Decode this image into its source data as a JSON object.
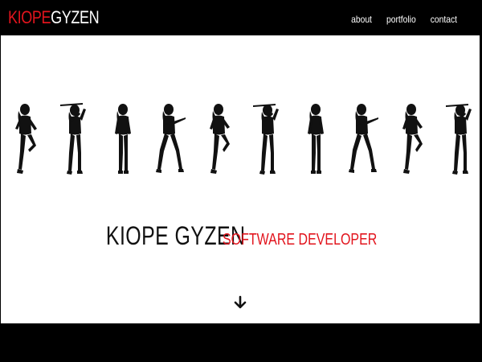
{
  "brand": {
    "part1": "KIOPE",
    "part2": "GYZEN",
    "accent_color": "#e2141d"
  },
  "nav": {
    "items": [
      "about",
      "portfolio",
      "contact"
    ]
  },
  "hero": {
    "name": "KIOPE GYZEN",
    "role": "SOFTWARE DEVELOPER",
    "figure_count": 10,
    "scroll_icon": "arrow-down-icon"
  }
}
